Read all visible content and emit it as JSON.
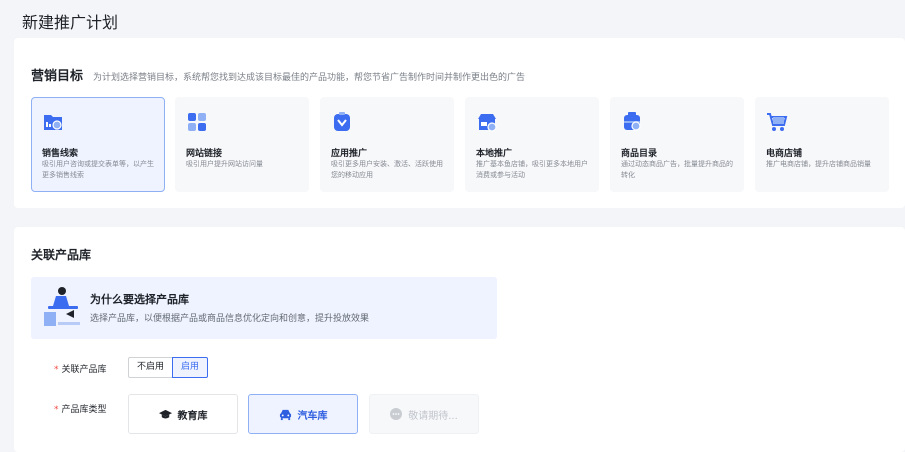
{
  "page": {
    "title": "新建推广计划"
  },
  "goals": {
    "title": "营销目标",
    "description": "为计划选择营销目标，系统帮您找到达成该目标最佳的产品功能，帮您节省广告制作时间并制作更出色的广告",
    "items": [
      {
        "name": "销售线索",
        "desc": "吸引用户咨询或提交表单等，以产生更多销售线索",
        "icon": "sales-leads-icon",
        "selected": true
      },
      {
        "name": "网站链接",
        "desc": "吸引用户提升网站访问量",
        "icon": "website-link-icon",
        "selected": false
      },
      {
        "name": "应用推广",
        "desc": "吸引更多用户安装、激活、活跃使用您的移动应用",
        "icon": "app-promotion-icon",
        "selected": false
      },
      {
        "name": "本地推广",
        "desc": "推广基本鱼店铺，吸引更多本地用户消费或参与活动",
        "icon": "local-promotion-icon",
        "selected": false
      },
      {
        "name": "商品目录",
        "desc": "通过动态商品广告，批量提升商品的转化",
        "icon": "product-catalog-icon",
        "selected": false
      },
      {
        "name": "电商店铺",
        "desc": "推广电商店铺，提升店铺商品销量",
        "icon": "ecommerce-store-icon",
        "selected": false
      }
    ]
  },
  "library": {
    "title": "关联产品库",
    "why": {
      "title": "为什么要选择产品库",
      "desc": "选择产品库，以便根据产品或商品信息优化定向和创意，提升投放效果"
    },
    "link_label": "关联产品库",
    "toggle": {
      "off_label": "不启用",
      "on_label": "启用",
      "selected": "启用"
    },
    "type_label": "产品库类型",
    "types": [
      {
        "label": "教育库",
        "icon": "graduation-cap-icon",
        "state": "normal"
      },
      {
        "label": "汽车库",
        "icon": "car-icon",
        "state": "selected"
      },
      {
        "label": "敬请期待...",
        "icon": "more-dots-icon",
        "state": "disabled"
      }
    ]
  },
  "colors": {
    "accent": "#3c6cf0",
    "selected_bg": "#eef3ff",
    "required": "#f54a45"
  }
}
